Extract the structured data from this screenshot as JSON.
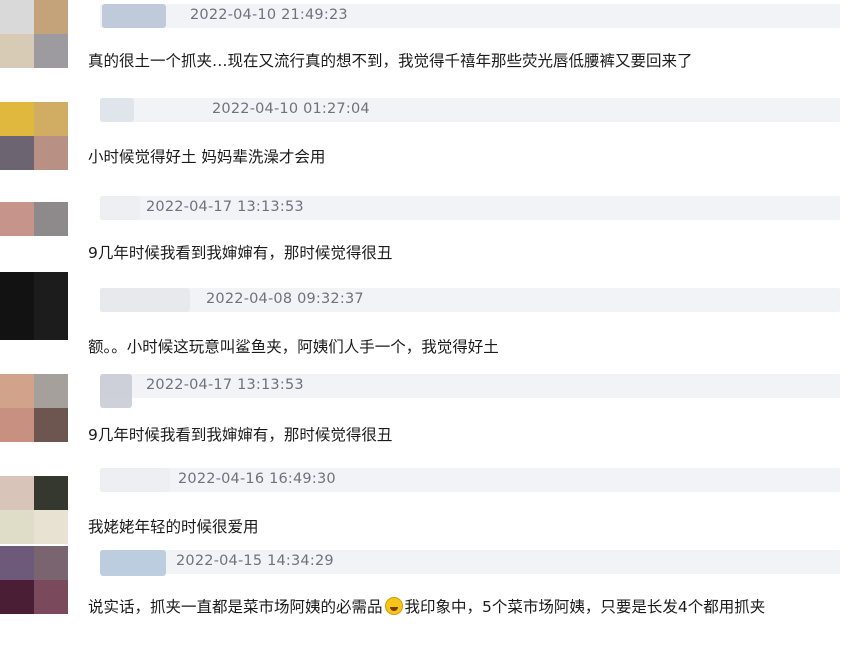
{
  "avatar_colors": {
    "row1": [
      "#d9d9d9",
      "#c4a37a"
    ],
    "row2": [
      "#d8cbb6",
      "#9d9aa0"
    ],
    "row3": [
      "#e0b83e",
      "#d0ad62"
    ],
    "row4": [
      "#6c6470",
      "#b89084"
    ],
    "row5": [
      "#c6948b",
      "#8e8a8c"
    ],
    "row6": [
      "#121212",
      "#1c1c1c"
    ],
    "row7": [
      "#d0a38a",
      "#a6a09c"
    ],
    "row8": [
      "#c89081",
      "#6e5650"
    ],
    "row9": [
      "#d8c4b8",
      "#35382e"
    ],
    "row10": [
      "#dfdcc8",
      "#e7e2d2"
    ],
    "row11": [
      "#6d5a7a",
      "#7a6470"
    ],
    "row12": [
      "#4a1e34",
      "#7a4a5c"
    ]
  },
  "comments": [
    {
      "timestamp": "2022-04-10 21:49:23",
      "text": "真的很土一个抓夹…现在又流行真的想不到，我觉得千禧年那些荧光唇低腰裤又要回来了",
      "blur_color": "#b9c6d8"
    },
    {
      "timestamp": "2022-04-10 01:27:04",
      "text": "小时候觉得好土 妈妈辈洗澡才会用",
      "blur_color": "#dde3ea"
    },
    {
      "timestamp": "2022-04-17 13:13:53",
      "text": "9几年时候我看到我婶婶有，那时候觉得很丑",
      "blur_color": "#eceef2"
    },
    {
      "timestamp": "2022-04-08 09:32:37",
      "text": "额。。小时候这玩意叫鲨鱼夹，阿姨们人手一个，我觉得好土",
      "blur_color": "#e6e8ec"
    },
    {
      "timestamp": "2022-04-17 13:13:53",
      "text": "9几年时候我看到我婶婶有，那时候觉得很丑",
      "blur_color": "#c9ccd6"
    },
    {
      "timestamp": "2022-04-16 16:49:30",
      "text": "我姥姥年轻的时候很爱用",
      "blur_color": "#eceef2"
    },
    {
      "timestamp": "2022-04-15 14:34:29",
      "text_before": "说实话，抓夹一直都是菜市场阿姨的必需品",
      "emoji": "grinning-face-emoji",
      "text_after": "我印象中，5个菜市场阿姨，只要是长发4个都用抓夹",
      "blur_color": "#b5c9dc"
    }
  ]
}
